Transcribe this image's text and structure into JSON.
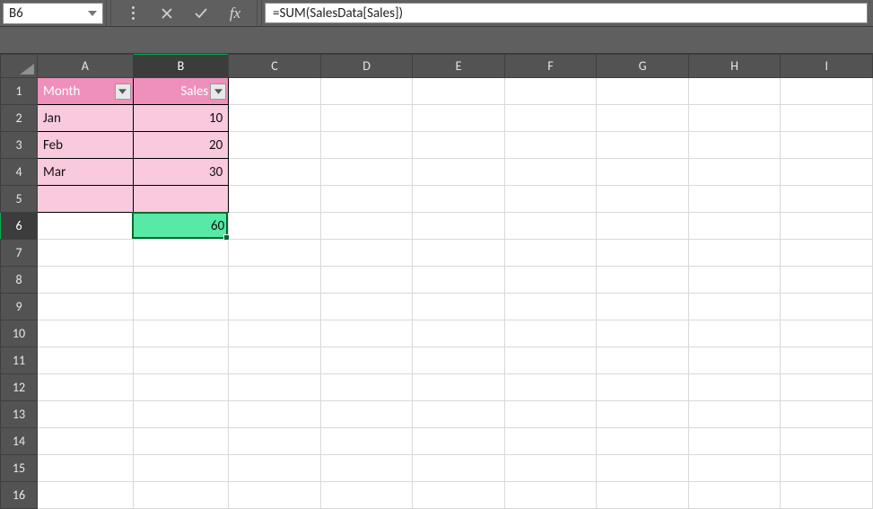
{
  "nameBox": {
    "value": "B6"
  },
  "formulaBar": {
    "cancel_tooltip": "Cancel",
    "enter_tooltip": "Enter",
    "fx_label": "fx",
    "formula": "=SUM(SalesData[Sales])"
  },
  "columns": [
    "A",
    "B",
    "C",
    "D",
    "E",
    "F",
    "G",
    "H",
    "I"
  ],
  "rowCount": 16,
  "activeCell": {
    "col": "B",
    "row": 6
  },
  "table": {
    "name": "SalesData",
    "headerRow": 1,
    "headers": [
      "Month",
      "Sales"
    ],
    "rows": [
      {
        "row": 2,
        "month": "Jan",
        "sales": 10
      },
      {
        "row": 3,
        "month": "Feb",
        "sales": 20
      },
      {
        "row": 4,
        "month": "Mar",
        "sales": 30
      },
      {
        "row": 5,
        "month": "",
        "sales": ""
      }
    ],
    "colors": {
      "header_fill": "#ee90bb",
      "body_fill": "#f9c9dd",
      "sum_fill": "#57e9a5"
    },
    "totalCell": {
      "ref": "B6",
      "value": 60
    }
  }
}
